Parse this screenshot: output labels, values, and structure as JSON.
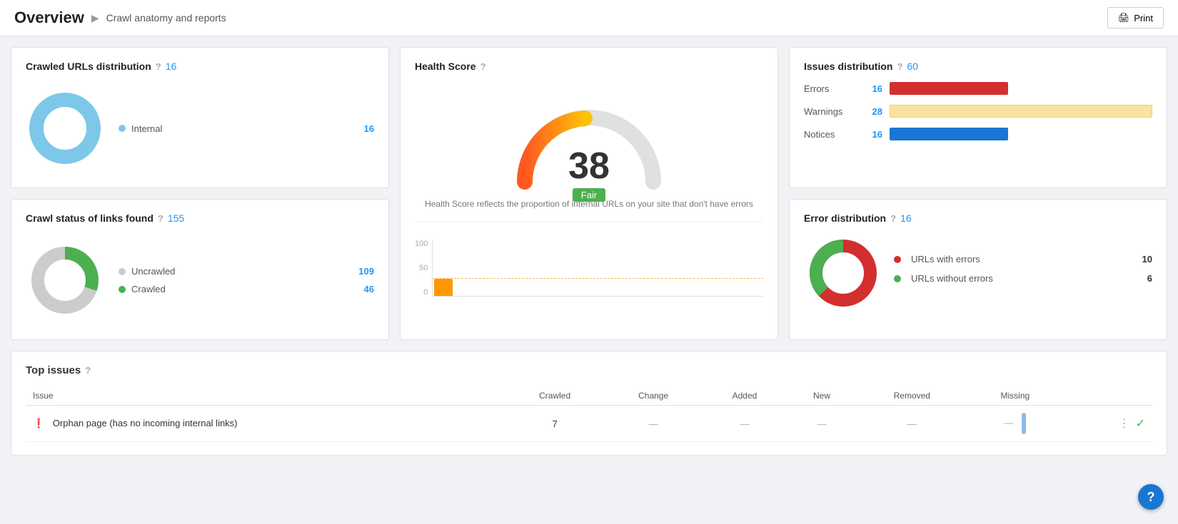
{
  "header": {
    "title": "Overview",
    "breadcrumb_icon": "▶",
    "breadcrumb_text": "Crawl anatomy and reports",
    "print_label": "Print"
  },
  "crawled_urls": {
    "title": "Crawled URLs distribution",
    "count": 16,
    "items": [
      {
        "label": "Internal",
        "color": "#7dc8e8",
        "value": 16
      }
    ]
  },
  "crawl_status": {
    "title": "Crawl status of links found",
    "count": 155,
    "items": [
      {
        "label": "Uncrawled",
        "color": "#ccc",
        "value": 109
      },
      {
        "label": "Crawled",
        "color": "#4caf50",
        "value": 46
      }
    ]
  },
  "health_score": {
    "title": "Health Score",
    "score": 38,
    "badge": "Fair",
    "description": "Health Score reflects the proportion of internal URLs on your site that don't have errors",
    "chart_y_labels": [
      "100",
      "50",
      "0"
    ]
  },
  "issues_distribution": {
    "title": "Issues distribution",
    "count": 60,
    "items": [
      {
        "label": "Errors",
        "count": 16,
        "bar_width": "45%",
        "bar_class": "bar-errors"
      },
      {
        "label": "Warnings",
        "count": 28,
        "bar_width": "100%",
        "bar_class": "bar-warnings"
      },
      {
        "label": "Notices",
        "count": 16,
        "bar_width": "45%",
        "bar_class": "bar-notices"
      }
    ]
  },
  "error_distribution": {
    "title": "Error distribution",
    "count": 16,
    "items": [
      {
        "label": "URLs with errors",
        "color": "#d32f2f",
        "value": 10
      },
      {
        "label": "URLs without errors",
        "color": "#4caf50",
        "value": 6
      }
    ]
  },
  "top_issues": {
    "title": "Top issues",
    "columns": [
      "Issue",
      "Crawled",
      "Change",
      "Added",
      "New",
      "Removed",
      "Missing"
    ],
    "rows": [
      {
        "type": "error",
        "issue": "Orphan page (has no incoming internal links)",
        "crawled": "7",
        "change": "—",
        "added": "—",
        "new": "—",
        "removed": "—",
        "missing": "—"
      }
    ]
  },
  "help_button": "?"
}
